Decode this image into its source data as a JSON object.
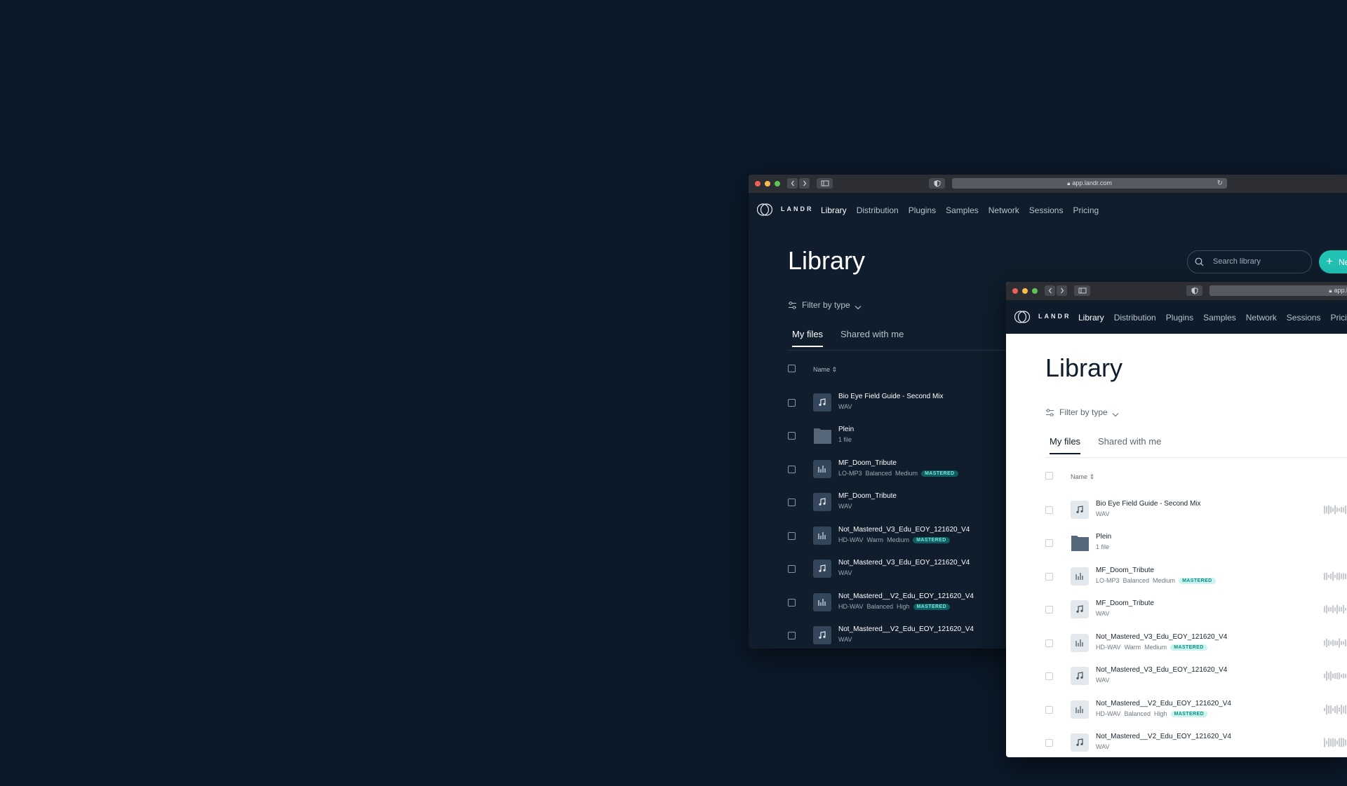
{
  "url": "app.landr.com",
  "brand": "LANDR",
  "nav": [
    "Library",
    "Distribution",
    "Plugins",
    "Samples",
    "Network",
    "Sessions",
    "Pricing"
  ],
  "page_title": "Library",
  "search_placeholder": "Search library",
  "new_button": "New",
  "filter_label": "Filter by type",
  "tabs": {
    "my_files": "My files",
    "shared": "Shared with me"
  },
  "column_name": "Name",
  "files": [
    {
      "name": "Bio Eye Field Guide - Second Mix",
      "type": "audio",
      "meta": [
        "WAV"
      ]
    },
    {
      "name": "Plein",
      "type": "folder",
      "meta": [
        "1 file"
      ]
    },
    {
      "name": "MF_Doom_Tribute",
      "type": "master",
      "meta": [
        "LO-MP3",
        "Balanced",
        "Medium"
      ],
      "badge": "MASTERED"
    },
    {
      "name": "MF_Doom_Tribute",
      "type": "audio",
      "meta": [
        "WAV"
      ]
    },
    {
      "name": "Not_Mastered_V3_Edu_EOY_121620_V4",
      "type": "master",
      "meta": [
        "HD-WAV",
        "Warm",
        "Medium"
      ],
      "badge": "MASTERED"
    },
    {
      "name": "Not_Mastered_V3_Edu_EOY_121620_V4",
      "type": "audio",
      "meta": [
        "WAV"
      ]
    },
    {
      "name": "Not_Mastered__V2_Edu_EOY_121620_V4",
      "type": "master",
      "meta": [
        "HD-WAV",
        "Balanced",
        "High"
      ],
      "badge": "MASTERED"
    },
    {
      "name": "Not_Mastered__V2_Edu_EOY_121620_V4",
      "type": "audio",
      "meta": [
        "WAV"
      ]
    }
  ],
  "colors": {
    "background": "#0b1929",
    "accent": "#21c3b5",
    "badge_text": "#7be6dc"
  },
  "icons": [
    "search-icon",
    "filter-icon",
    "chevron-down-icon",
    "music-note-icon",
    "waveform-icon",
    "folder-icon",
    "lock-icon",
    "reload-icon",
    "shield-icon",
    "sidebar-icon"
  ]
}
